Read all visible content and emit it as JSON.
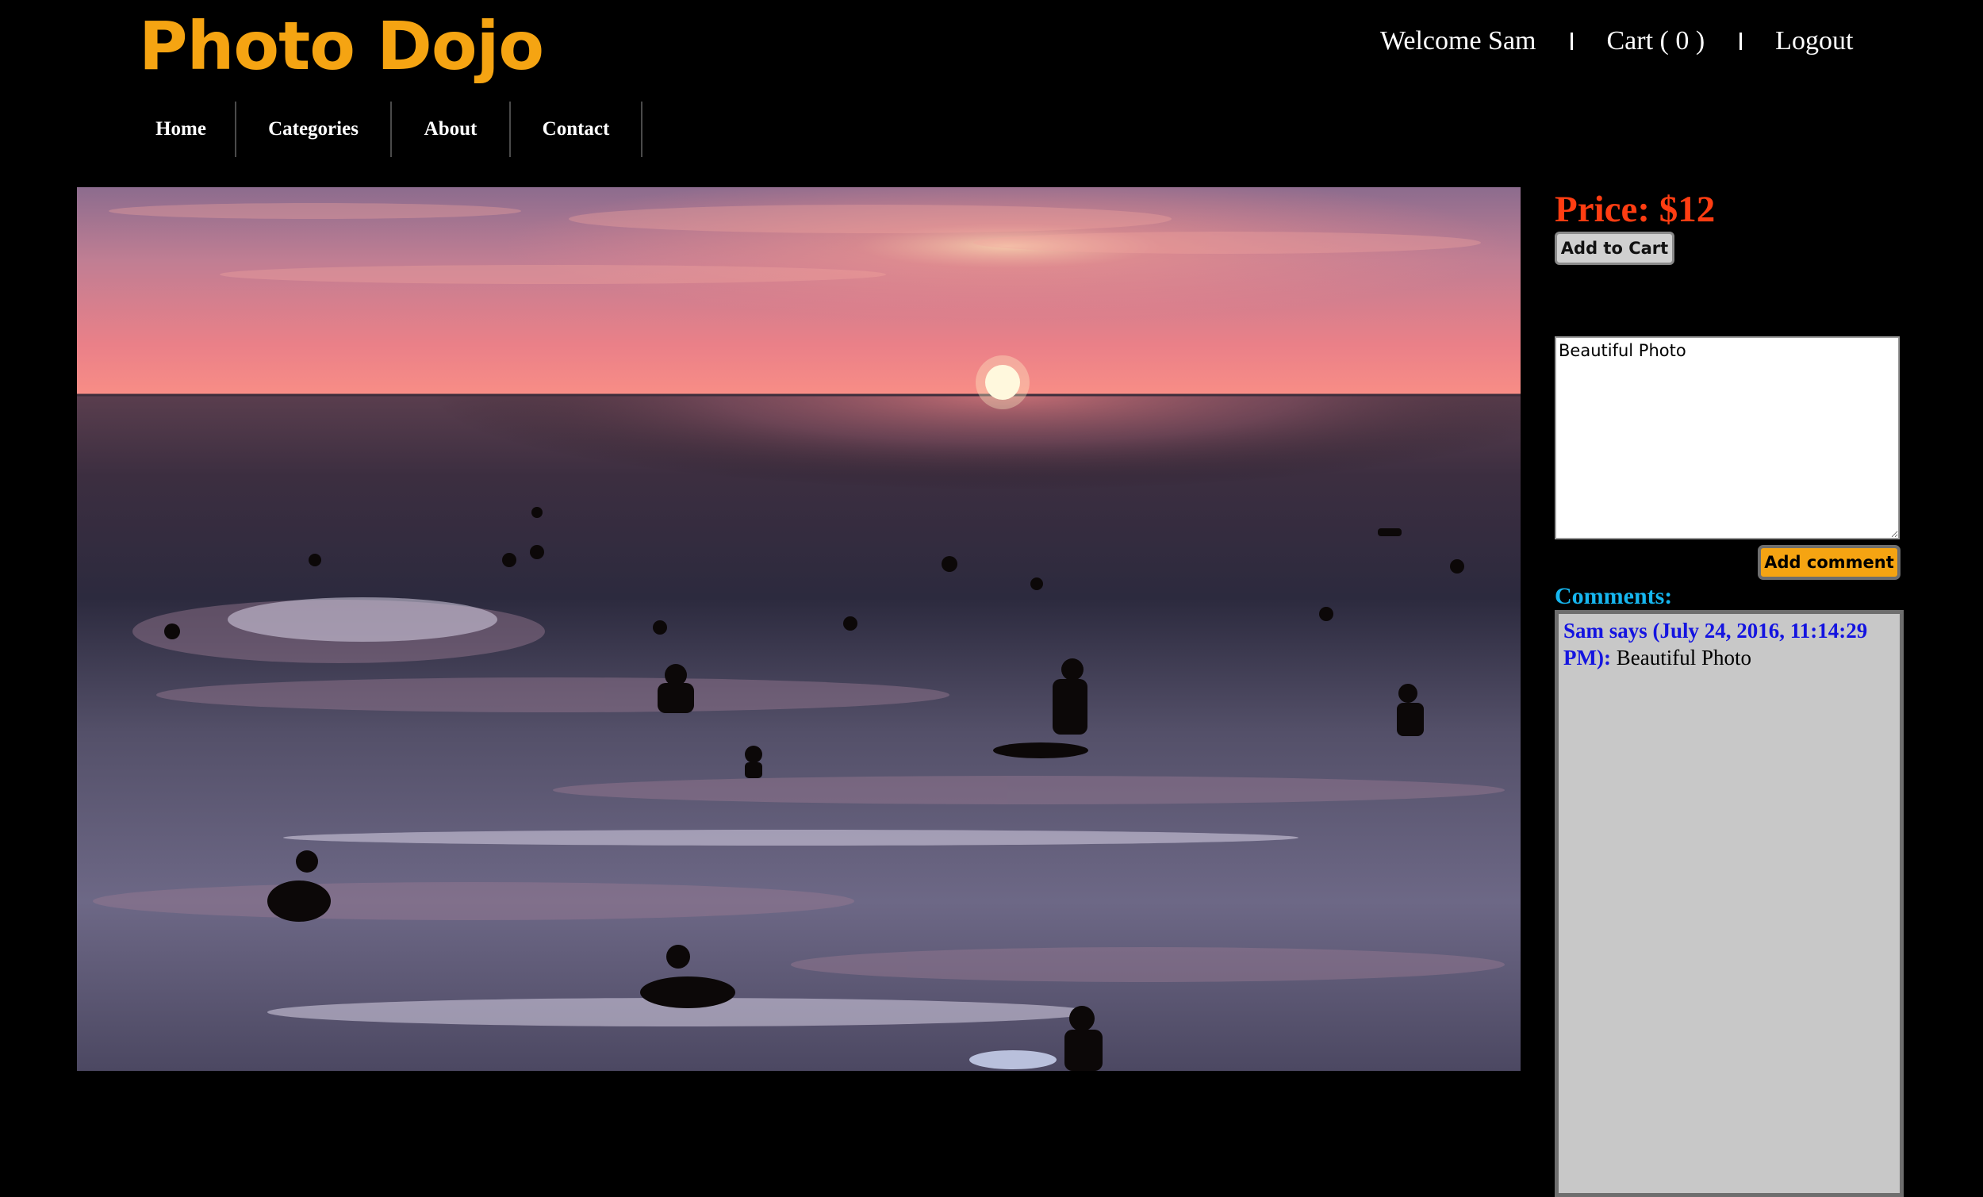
{
  "site": {
    "logo": "Photo Dojo",
    "brand_color": "#f5a412"
  },
  "user_nav": {
    "welcome": "Welcome Sam",
    "cart": "Cart ( 0 )",
    "logout": "Logout"
  },
  "main_nav": {
    "items": [
      {
        "label": "Home"
      },
      {
        "label": "Categories"
      },
      {
        "label": "About"
      },
      {
        "label": "Contact"
      }
    ]
  },
  "product": {
    "price": "Price: $12",
    "add_to_cart_label": "Add to Cart",
    "price_color": "#ff3d12"
  },
  "comment_form": {
    "value": "Beautiful Photo",
    "submit_label": "Add comment"
  },
  "comments": {
    "title": "Comments:",
    "items": [
      {
        "author_line": "Sam says (July 24, 2016, 11:14:29 PM):",
        "text": "Beautiful Photo"
      }
    ]
  }
}
